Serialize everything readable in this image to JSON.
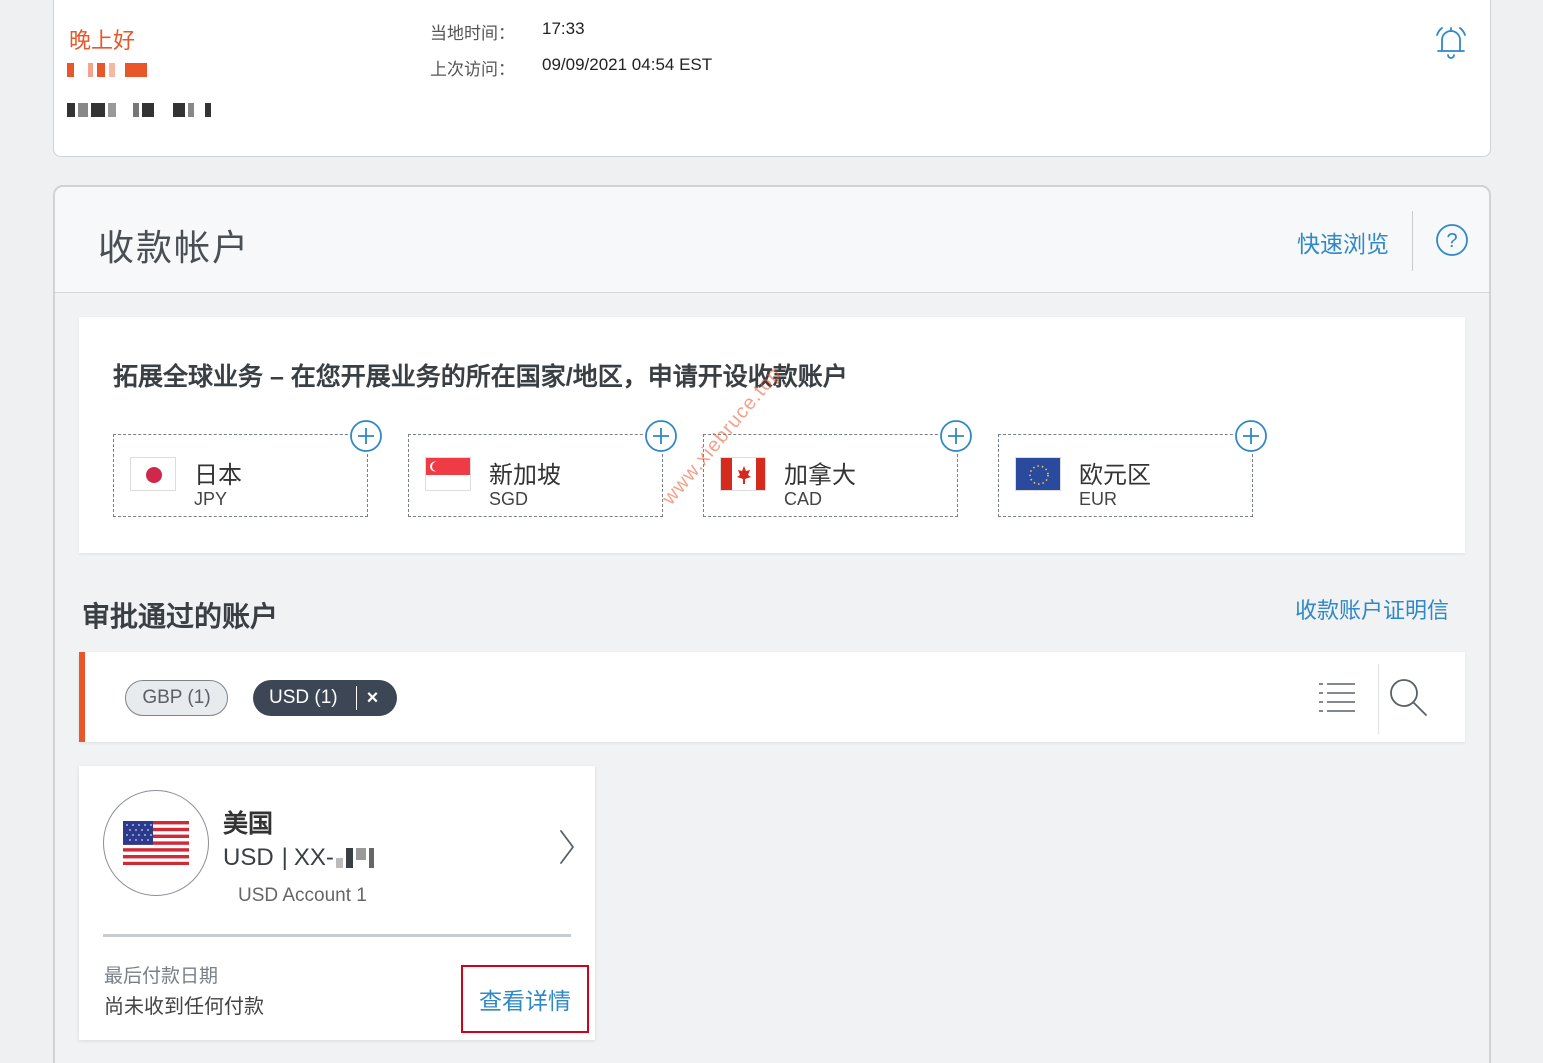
{
  "header": {
    "greeting": "晚上好",
    "local_time_label": "当地时间：",
    "local_time_value": "17:33",
    "last_visit_label": "上次访问：",
    "last_visit_value": "09/09/2021 04:54 EST"
  },
  "panel": {
    "title": "收款帐户",
    "quick_browse": "快速浏览",
    "help": "?"
  },
  "expand": {
    "title": "拓展全球业务 – 在您开展业务的所在国家/地区，申请开设收款账户",
    "countries": [
      {
        "name": "日本",
        "code": "JPY"
      },
      {
        "name": "新加坡",
        "code": "SGD"
      },
      {
        "name": "加拿大",
        "code": "CAD"
      },
      {
        "name": "欧元区",
        "code": "EUR"
      }
    ]
  },
  "approved": {
    "title": "审批通过的账户",
    "proof_link": "收款账户证明信",
    "filters": [
      {
        "label": "GBP (1)"
      },
      {
        "label": "USD (1)",
        "close": "×"
      }
    ]
  },
  "account": {
    "country": "美国",
    "currency": "USD",
    "separator": "|",
    "number_prefix": "XX-",
    "name": "USD Account 1",
    "last_payment_label": "最后付款日期",
    "last_payment_value": "尚未收到任何付款",
    "detail_button": "查看详情"
  },
  "watermark": "www.xiebruce.top",
  "colors": {
    "accent": "#e8562a",
    "link": "#2f88c7",
    "chip_active": "#3c4654",
    "highlight_border": "#d0021b"
  }
}
